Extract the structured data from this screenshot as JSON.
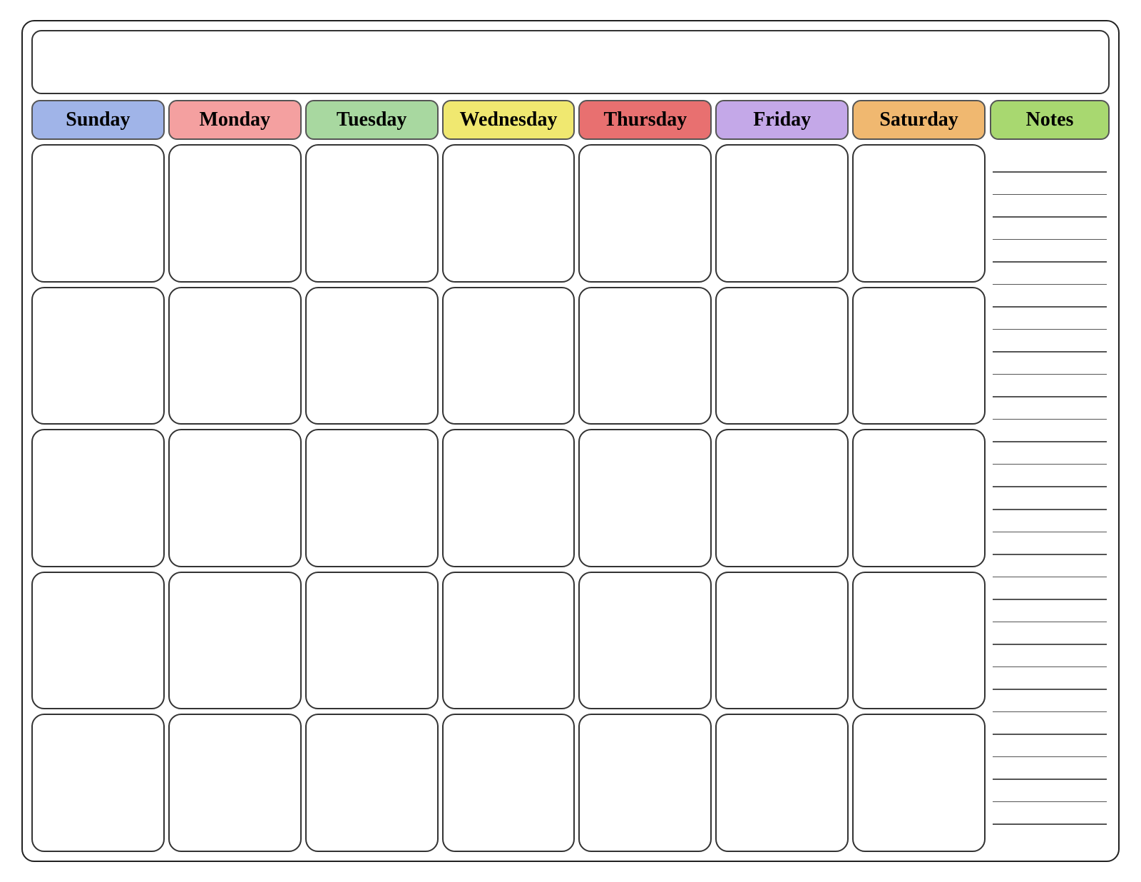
{
  "title": "",
  "days": [
    {
      "label": "Sunday",
      "class": "sunday"
    },
    {
      "label": "Monday",
      "class": "monday"
    },
    {
      "label": "Tuesday",
      "class": "tuesday"
    },
    {
      "label": "Wednesday",
      "class": "wednesday"
    },
    {
      "label": "Thursday",
      "class": "thursday"
    },
    {
      "label": "Friday",
      "class": "friday"
    },
    {
      "label": "Saturday",
      "class": "saturday"
    }
  ],
  "notes_label": "Notes",
  "num_rows": 5,
  "num_note_lines": 30
}
